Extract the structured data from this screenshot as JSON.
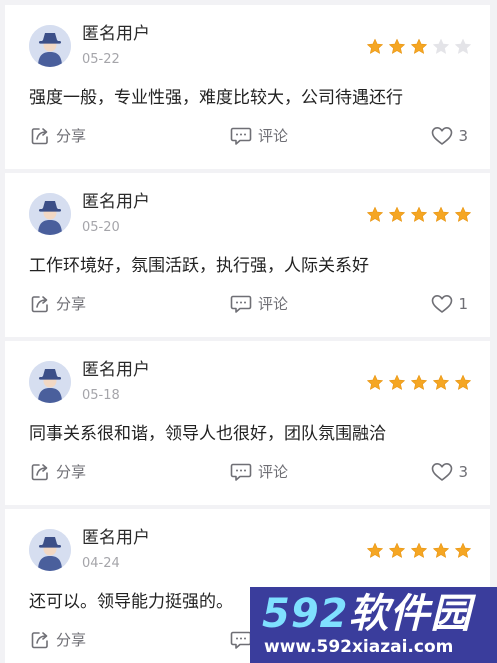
{
  "reviews": [
    {
      "username": "匿名用户",
      "date": "05-22",
      "rating": 3,
      "max_rating": 5,
      "content": "强度一般，专业性强，难度比较大，公司待遇还行",
      "share_label": "分享",
      "comment_label": "评论",
      "like_count": "3"
    },
    {
      "username": "匿名用户",
      "date": "05-20",
      "rating": 5,
      "max_rating": 5,
      "content": "工作环境好，氛围活跃，执行强，人际关系好",
      "share_label": "分享",
      "comment_label": "评论",
      "like_count": "1"
    },
    {
      "username": "匿名用户",
      "date": "05-18",
      "rating": 5,
      "max_rating": 5,
      "content": "同事关系很和谐，领导人也很好，团队氛围融洽",
      "share_label": "分享",
      "comment_label": "评论",
      "like_count": "3"
    },
    {
      "username": "匿名用户",
      "date": "04-24",
      "rating": 5,
      "max_rating": 5,
      "content": "还可以。领导能力挺强的。",
      "share_label": "分享",
      "comment_label": "评论",
      "like_count": ""
    }
  ],
  "watermark": {
    "brand_number": "592",
    "brand_text": "软件园",
    "url": "www.592xiazai.com"
  },
  "colors": {
    "star_filled": "#f5a623",
    "star_empty": "#e4e4e8",
    "avatar_bg": "#d6def0",
    "avatar_figure": "#4a5f9c",
    "watermark_bg": "#3a3d9c"
  },
  "icons": {
    "avatar": "anonymous-user-icon",
    "share": "share-icon",
    "comment": "comment-icon",
    "like": "heart-icon",
    "rating": "star-icon"
  }
}
